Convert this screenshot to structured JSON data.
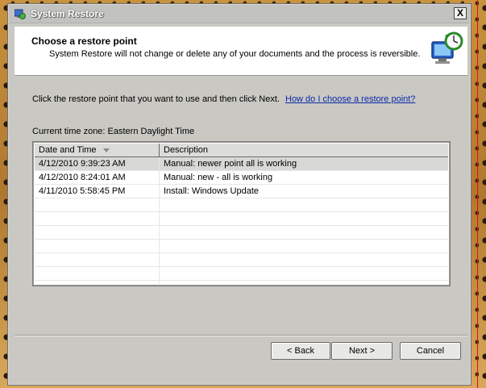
{
  "window": {
    "title": "System Restore",
    "close_label": "X"
  },
  "header": {
    "title": "Choose a restore point",
    "subtitle": "System Restore will not change or delete any of your documents and the process is reversible."
  },
  "instructions": {
    "text": "Click the restore point that you want to use and then click Next.",
    "link": "How do I choose a restore point?"
  },
  "timezone": "Current time zone: Eastern Daylight Time",
  "list": {
    "columns": [
      "Date and Time",
      "Description"
    ],
    "rows": [
      {
        "date": "4/12/2010 9:39:23 AM",
        "desc": "Manual: newer point all is working",
        "selected": true
      },
      {
        "date": "4/12/2010 8:24:01 AM",
        "desc": "Manual: new - all is working",
        "selected": false
      },
      {
        "date": "4/11/2010 5:58:45 PM",
        "desc": "Install: Windows Update",
        "selected": false
      }
    ]
  },
  "buttons": {
    "back": "< Back",
    "next": "Next >",
    "cancel": "Cancel"
  },
  "colors": {
    "link": "#0b2aa8",
    "selected_row": "#d8d8d6"
  },
  "icons": {
    "title": "system-restore-icon",
    "header": "restore-clock-icon",
    "sort": "sort-down-icon"
  }
}
